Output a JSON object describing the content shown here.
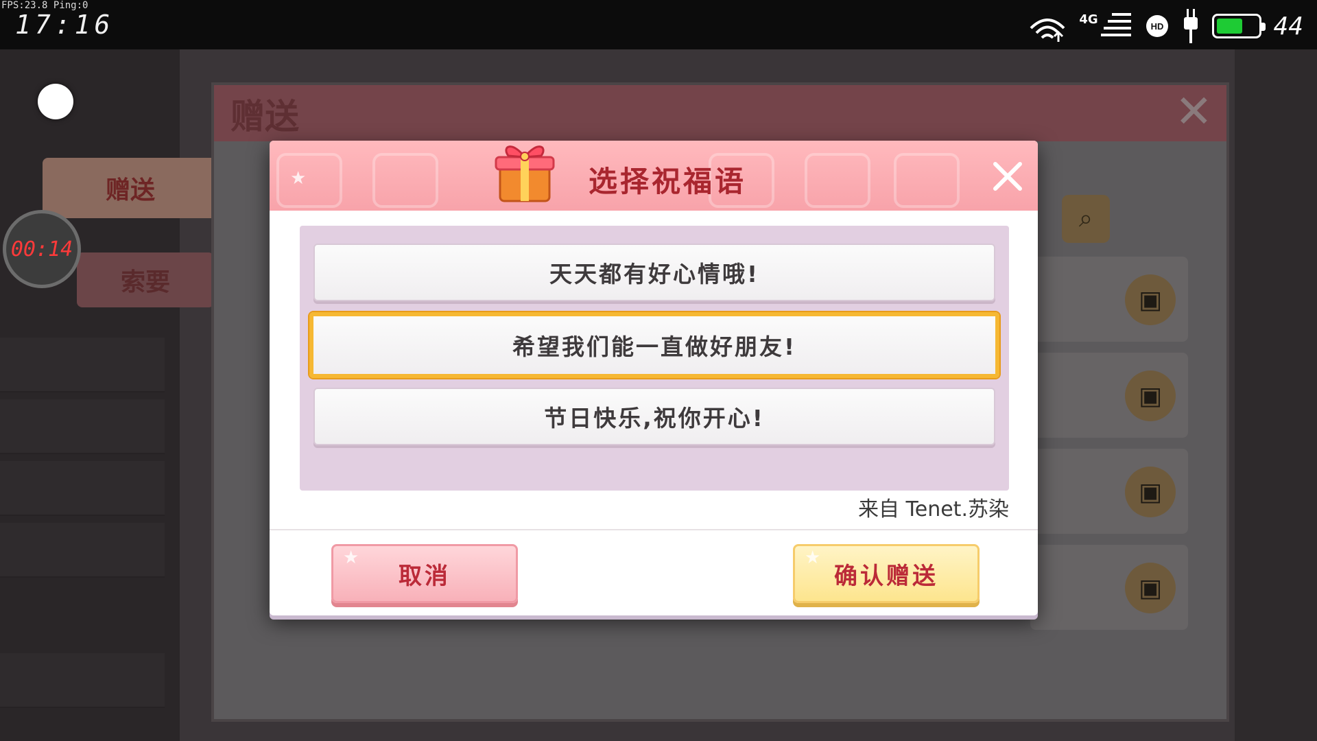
{
  "status_bar": {
    "fps_text": "FPS:23.8  Ping:0",
    "time": "17:16",
    "network": "4G",
    "battery_level": "44",
    "battery_fill": 0.65,
    "battery_color": "#1ecb34"
  },
  "background": {
    "panel_title": "赠送",
    "tabs": {
      "gift": "赠送",
      "ask": "索要"
    },
    "timer": "00:14"
  },
  "dialog": {
    "title": "选择祝福语",
    "messages": [
      {
        "text": "天天都有好心情哦!",
        "selected": false
      },
      {
        "text": "希望我们能一直做好朋友!",
        "selected": true
      },
      {
        "text": "节日快乐,祝你开心!",
        "selected": false
      }
    ],
    "from_label": "来自",
    "from_name": "Tenet.苏染",
    "cancel_label": "取消",
    "confirm_label": "确认赠送"
  },
  "colors": {
    "title": "#a9262f",
    "selected_border": "#f6b833",
    "header": "#f8a3aa",
    "confirm_bg": "#fde58e",
    "cancel_bg": "#f8b1b9"
  },
  "icons": {
    "gift": "gift-box-icon",
    "close": "close-x-icon",
    "search": "search-icon",
    "wifi": "wifi-icon",
    "hd": "hd-voice-icon",
    "charging": "charging-plug-icon",
    "battery": "battery-icon"
  }
}
